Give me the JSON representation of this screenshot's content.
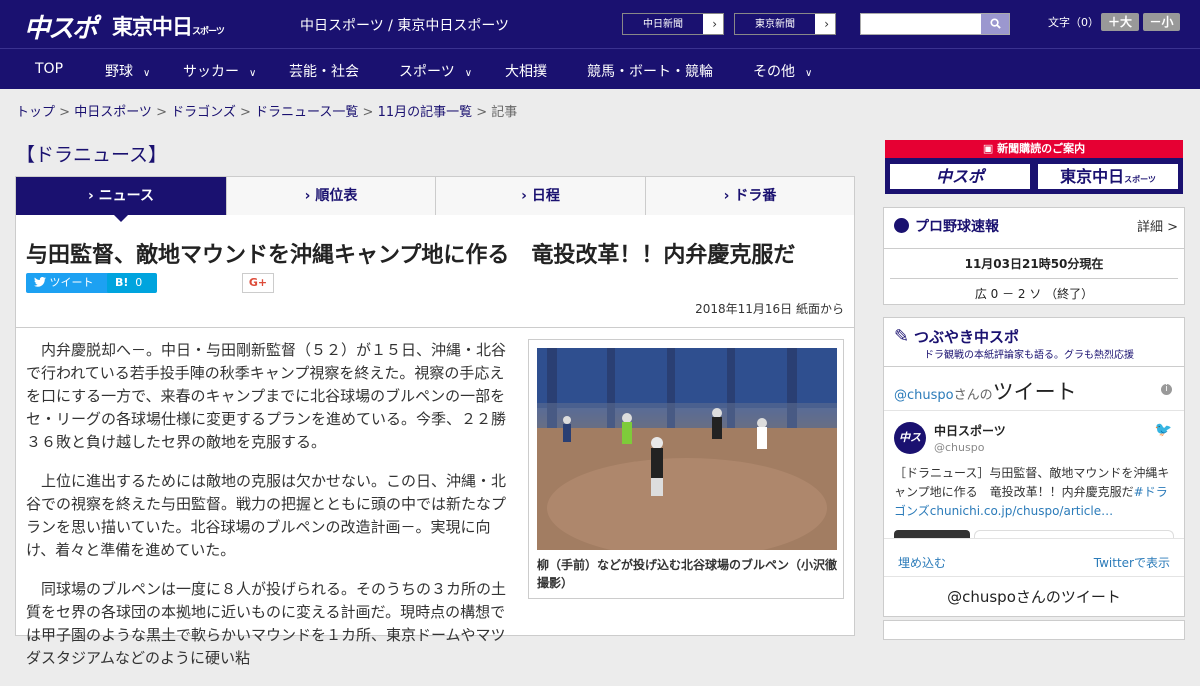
{
  "header": {
    "logo_chuspo": "中スポ",
    "logo_tokyo": "東京中日",
    "logo_tokyo_small": "スポーツ",
    "title": "中日スポーツ / 東京中日スポーツ",
    "paper_btn1": "中日新聞",
    "paper_btn2": "東京新聞",
    "font_size_label": "文字（0）",
    "font_up": "＋大",
    "font_down": "－小"
  },
  "nav": {
    "items": [
      "TOP",
      "野球",
      "サッカー",
      "芸能・社会",
      "スポーツ",
      "大相撲",
      "競馬・ボート・競輪",
      "その他"
    ]
  },
  "breadcrumb": {
    "items": [
      "トップ",
      "中日スポーツ",
      "ドラゴンズ",
      "ドラニュース一覧",
      "11月の記事一覧"
    ],
    "current": "記事"
  },
  "section_title": "【ドラニュース】",
  "tabs": [
    "ニュース",
    "順位表",
    "日程",
    "ドラ番"
  ],
  "article": {
    "headline": "与田監督、敵地マウンドを沖縄キャンプ地に作る　竜投改革！！内弁慶克服だ",
    "tweet_label": "ツイート",
    "hatena_label": "B!",
    "hatena_count": "0",
    "gplus_label": "G+",
    "date": "2018年11月16日 紙面から",
    "paragraphs": [
      "内弁慶脱却へ－。中日・与田剛新監督（５２）が１５日、沖縄・北谷で行われている若手投手陣の秋季キャンプ視察を終えた。視察の手応えを口にする一方で、来春のキャンプまでに北谷球場のブルペンの一部をセ・リーグの各球場仕様に変更するプランを進めている。今季、２２勝３６敗と負け越したセ界の敵地を克服する。",
      "上位に進出するためには敵地の克服は欠かせない。この日、沖縄・北谷での視察を終えた与田監督。戦力の把握とともに頭の中では新たなプランを思い描いていた。北谷球場のブルペンの改造計画－。実現に向け、着々と準備を進めていた。",
      "同球場のブルペンは一度に８人が投げられる。そのうちの３カ所の土質をセ界の各球団の本拠地に近いものに変える計画だ。現時点の構想では甲子園のような黒土で軟らかいマウンドを１カ所、東京ドームやマツダスタジアムなどのように硬い粘"
    ],
    "photo_caption": "柳（手前）などが投げ込む北谷球場のブルペン（小沢徹撮影）"
  },
  "sidebar": {
    "banner_title": "新聞購読のご案内",
    "banner_btn1": "中スポ",
    "banner_btn2": "東京中日",
    "banner_btn2_small": "スポーツ",
    "score_title": "プロ野球速報",
    "score_detail": "詳細 >",
    "score_time": "11月03日21時50分現在",
    "score_line": "広 0 － 2 ソ （終了）",
    "tweet_title": "つぶやき中スポ",
    "tweet_sub": "ドラ観戦の本紙評論家も語る。グラも熱烈応援",
    "tw_handle_head": "@chuspo",
    "tw_handle_head_tail": "さんの",
    "tw_handle_big": "ツイート",
    "tw_user": "中日スポーツ",
    "tw_user_handle": "@chuspo",
    "tw_text": "［ドラニュース］与田監督、敵地マウンドを沖縄キャンプ地に作る　竜投改革！！内弁慶克服だ",
    "tw_link": "#ドラゴンズchunichi.co.jp/chuspo/article…",
    "embed_label": "埋め込む",
    "view_on_twitter": "Twitterで表示",
    "footer_tweets": "@chuspoさんのツイート"
  }
}
